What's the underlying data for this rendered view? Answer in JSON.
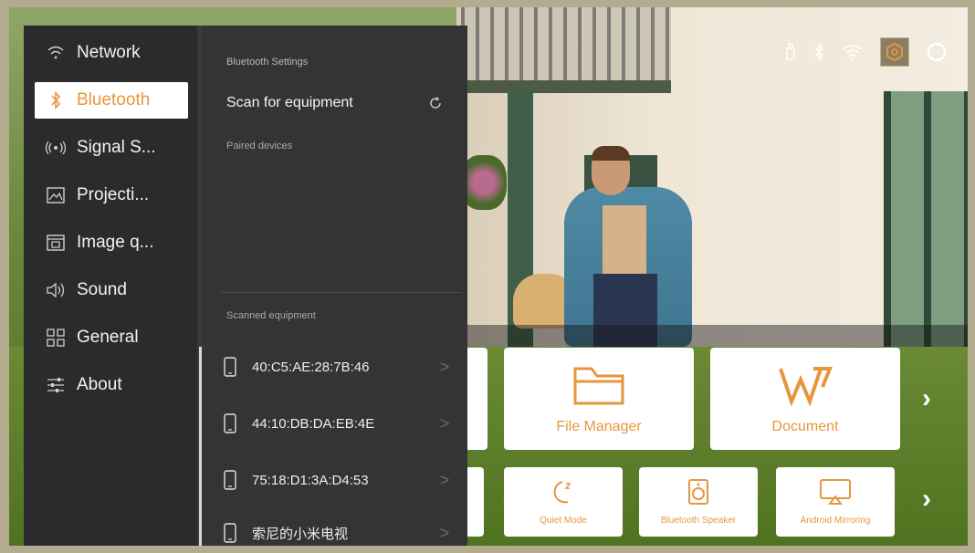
{
  "status_bar": {
    "icons": [
      "usb-icon",
      "bluetooth-icon",
      "wifi-icon",
      "settings-hexagon-icon",
      "circle-icon"
    ]
  },
  "nav": {
    "items": [
      {
        "label": "Network",
        "icon": "wifi-icon"
      },
      {
        "label": "Bluetooth",
        "icon": "bluetooth-icon",
        "selected": true
      },
      {
        "label": "Signal S...",
        "icon": "signal-source-icon"
      },
      {
        "label": "Projecti...",
        "icon": "projection-icon"
      },
      {
        "label": "Image q...",
        "icon": "image-quality-icon"
      },
      {
        "label": "Sound",
        "icon": "speaker-icon"
      },
      {
        "label": "General",
        "icon": "grid-icon"
      },
      {
        "label": "About",
        "icon": "sliders-icon"
      }
    ]
  },
  "bluetooth": {
    "header": "Bluetooth Settings",
    "scan_label": "Scan for equipment",
    "paired_label": "Paired devices",
    "scanned_label": "Scanned equipment",
    "devices": [
      {
        "name": "40:C5:AE:28:7B:46"
      },
      {
        "name": "44:10:DB:DA:EB:4E"
      },
      {
        "name": "75:18:D1:3A:D4:53"
      },
      {
        "name": "索尼的小米电视"
      }
    ]
  },
  "apps": {
    "row1": [
      {
        "label": "File Manager",
        "icon": "folder-icon"
      },
      {
        "label": "Document",
        "icon": "wps-document-icon"
      }
    ],
    "row2": [
      {
        "label": "Quiet Mode",
        "icon": "moon-icon"
      },
      {
        "label": "Bluetooth Speaker",
        "icon": "speaker-box-icon"
      },
      {
        "label": "Android Mirroring",
        "icon": "cast-icon"
      }
    ]
  },
  "colors": {
    "accent": "#e6973d",
    "nav_bg": "#2b2b2d",
    "panel_bg": "#343436",
    "tile_bg": "#ffffff"
  }
}
